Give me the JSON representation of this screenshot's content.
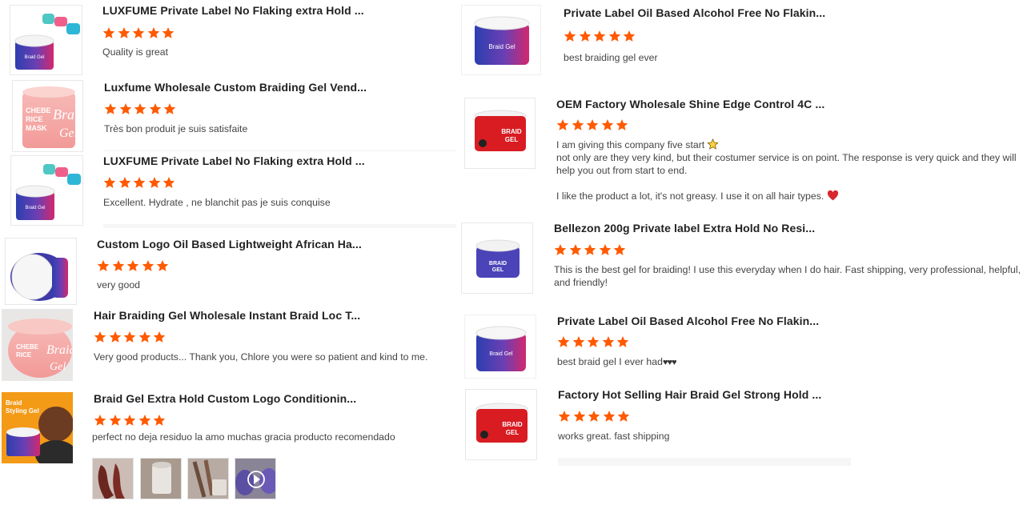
{
  "reviews_left": [
    {
      "title": "LUXFUME Private Label No Flaking extra Hold ...",
      "rating": 5,
      "text": "Quality is great",
      "image_icon": "braid-gel-jar-white-with-lids-icon"
    },
    {
      "title": "Luxfume Wholesale Custom Braiding Gel Vend...",
      "rating": 5,
      "text": "Très bon produit je suis satisfaite",
      "image_icon": "pink-braid-gel-jar-icon"
    },
    {
      "title": "LUXFUME Private Label No Flaking extra Hold ...",
      "rating": 5,
      "text": "Excellent.  Hydrate , ne blanchit pas je suis conquise",
      "image_icon": "braid-gel-jar-white-with-lids-icon"
    },
    {
      "title": "Custom Logo Oil Based Lightweight African Ha...",
      "rating": 5,
      "text": "very good",
      "image_icon": "blue-braid-gel-jar-icon"
    },
    {
      "title": "Hair Braiding Gel Wholesale Instant Braid Loc T...",
      "rating": 5,
      "text": "Very good products... Thank you, Chlore you were so patient and kind to me.",
      "image_icon": "pink-braid-gel-jar-icon"
    },
    {
      "title": "Braid Gel Extra Hold Custom Logo Conditionin...",
      "rating": 5,
      "text": "perfect no deja residuo la amo muchas gracia producto recomendado",
      "image_icon": "braid-styling-gel-promo-icon",
      "image_text": "Braid Styling Gel"
    }
  ],
  "reviews_right": [
    {
      "title": "Private Label Oil Based Alcohol Free No Flakin...",
      "rating": 5,
      "text": "best braiding gel ever",
      "image_icon": "blue-braid-gel-jar-icon"
    },
    {
      "title": "OEM Factory Wholesale Shine Edge Control 4C ...",
      "rating": 5,
      "text_lines": [
        "I am giving this company five start",
        "not only are they very kind, but their costumer service is on point. The response is very quick and they will help you out from start to end.",
        "",
        "I like the product a lot, it's not greasy. I use it on all hair types."
      ],
      "image_icon": "red-braid-gel-jar-icon"
    },
    {
      "title": "Bellezon 200g Private label Extra Hold No Resi...",
      "rating": 5,
      "text": "This is the best gel for braiding! I use this everyday when I do hair. Fast shipping, very professional, helpful, and friendly!",
      "image_icon": "purple-braid-gel-jar-icon"
    },
    {
      "title": "Private Label Oil Based Alcohol Free No Flakin...",
      "rating": 5,
      "text": "best braid gel I ever had",
      "text_suffix": "♥♥♥",
      "image_icon": "blue-braid-gel-jar-icon"
    },
    {
      "title": "Factory Hot Selling Hair Braid Gel Strong Hold ...",
      "rating": 5,
      "text": "works great. fast shipping",
      "image_icon": "red-braid-gel-jar-icon"
    }
  ],
  "jar_labels": {
    "braid": "BRAID",
    "gel": "GEL",
    "braid_gel": "Braid Gel",
    "chebe": "CHEBE RICE MASK",
    "braid_script": "Braid",
    "gel_script": "Gel"
  },
  "media_thumbs": [
    "hair-photo-thumbnail-icon",
    "jar-photo-thumbnail-icon",
    "braids-photo-thumbnail-icon",
    "video-thumbnail-icon"
  ],
  "colors": {
    "star": "#ff5a00",
    "title": "#222222",
    "text": "#444444"
  }
}
